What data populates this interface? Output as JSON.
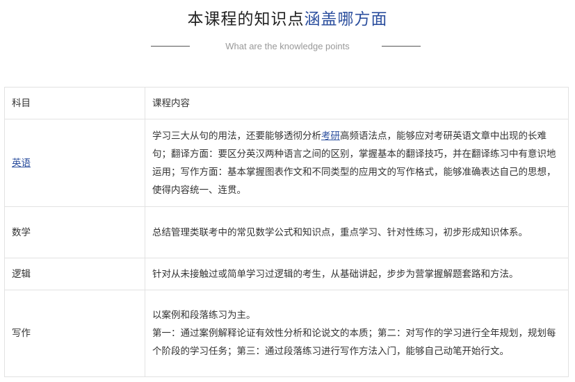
{
  "header": {
    "title_main": "本课程的知识点",
    "title_accent": "涵盖哪方面",
    "subtitle": "What are the knowledge points",
    "accent_color": "#2c4f9e"
  },
  "table": {
    "columns": [
      "科目",
      "课程内容"
    ],
    "rows": [
      {
        "subject": "英语",
        "subject_is_link": true,
        "content_pre": "学习三大从句的用法，还要能够透彻分析",
        "content_link": "考研",
        "content_post": "高频语法点，能够应对考研英语文章中出现的长难句；翻译方面：要区分英汉两种语言之间的区别，掌握基本的翻译技巧，并在翻译练习中有意识地运用；写作方面：基本掌握图表作文和不同类型的应用文的写作格式，能够准确表达自己的思想，使得内容统一、连贯。"
      },
      {
        "subject": "数学",
        "content": "总结管理类联考中的常见数学公式和知识点，重点学习、针对性练习，初步形成知识体系。"
      },
      {
        "subject": "逻辑",
        "content": "针对从未接触过或简单学习过逻辑的考生，从基础讲起，步步为营掌握解题套路和方法。"
      },
      {
        "subject": "写作",
        "content_line1": "以案例和段落练习为主。",
        "content_line2": "第一：通过案例解释论证有效性分析和论说文的本质；第二：对写作的学习进行全年规划，规划每个阶段的学习任务；第三：通过段落练习进行写作方法入门，能够自己动笔开始行文。"
      }
    ]
  }
}
